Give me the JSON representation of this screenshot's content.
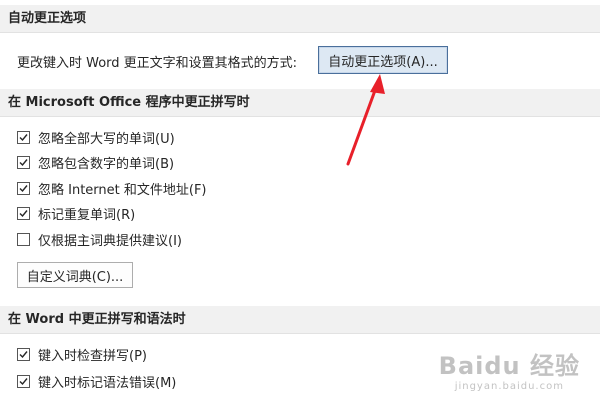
{
  "autocorrect_section": {
    "header": "自动更正选项",
    "description": "更改键入时 Word 更正文字和设置其格式的方式:",
    "button_label": "自动更正选项(A)..."
  },
  "office_spelling_section": {
    "header": "在 Microsoft Office 程序中更正拼写时",
    "options": [
      {
        "label": "忽略全部大写的单词(U)",
        "checked": true
      },
      {
        "label": "忽略包含数字的单词(B)",
        "checked": true
      },
      {
        "label": "忽略 Internet 和文件地址(F)",
        "checked": true
      },
      {
        "label": "标记重复单词(R)",
        "checked": true
      },
      {
        "label": "仅根据主词典提供建议(I)",
        "checked": false
      }
    ],
    "custom_dict_button": "自定义词典(C)..."
  },
  "word_spelling_section": {
    "header": "在 Word 中更正拼写和语法时",
    "options": [
      {
        "label": "键入时检查拼写(P)",
        "checked": true
      },
      {
        "label": "键入时标记语法错误(M)",
        "checked": true
      }
    ]
  },
  "watermark": {
    "main": "Baidu 经验",
    "sub": "jingyan.baidu.com"
  },
  "colors": {
    "section_bg": "#f1f1f1",
    "focused_button_bg": "#dde8f3",
    "annotation_arrow": "#e8202a"
  }
}
